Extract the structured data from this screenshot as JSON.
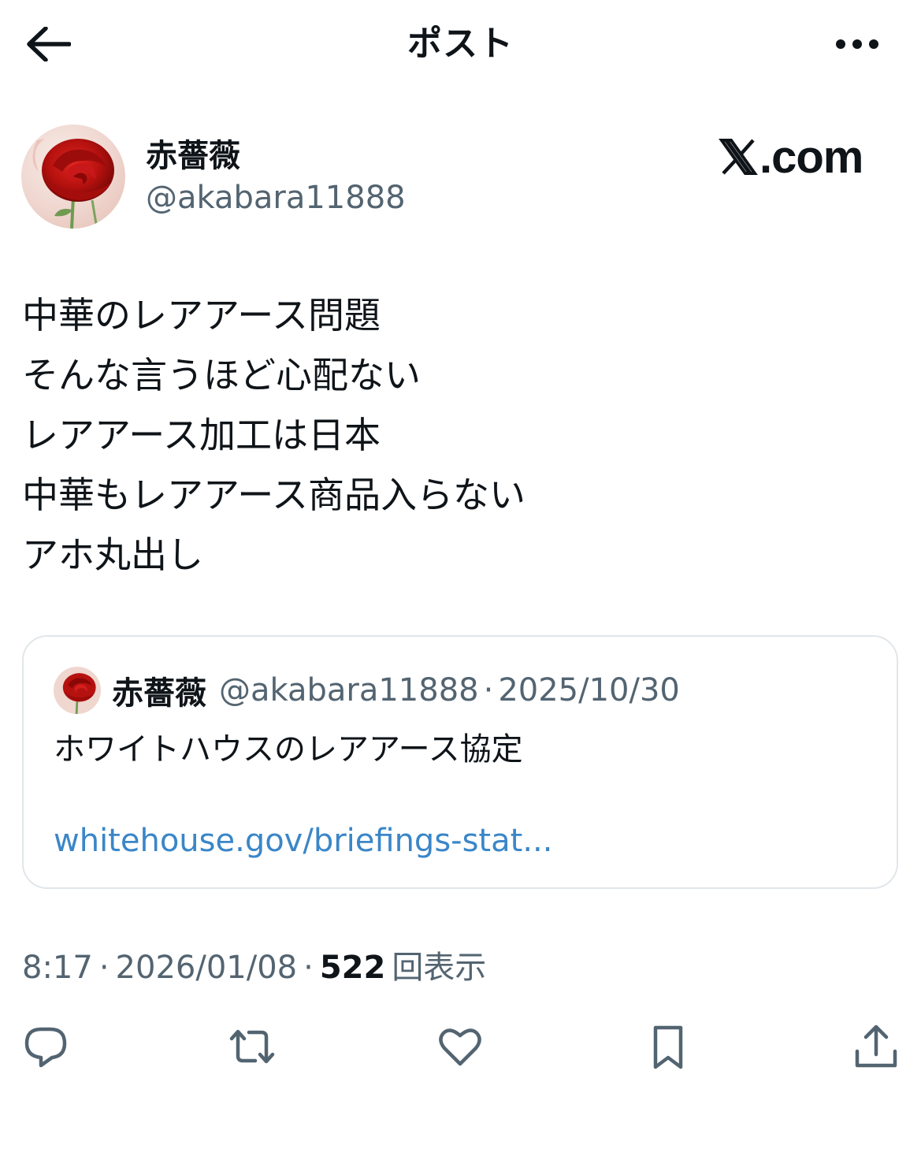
{
  "header": {
    "title": "ポスト",
    "back_icon": "arrow-left-icon",
    "more_icon": "more-horizontal-icon"
  },
  "author": {
    "name": "赤薔薇",
    "handle": "@akabara11888",
    "avatar": "red-rose-avatar"
  },
  "brand": {
    "x_glyph": "𝕏",
    "suffix": ".com"
  },
  "post": {
    "lines": [
      "中華のレアアース問題",
      "そんな言うほど心配ない",
      "レアアース加工は日本",
      "中華もレアアース商品入らない",
      "アホ丸出し"
    ]
  },
  "quote": {
    "name": "赤薔薇",
    "handle": "@akabara11888",
    "separator": "·",
    "date": "2025/10/30",
    "text": "ホワイトハウスのレアアース協定",
    "link": "whitehouse.gov/briefings-stat..."
  },
  "meta": {
    "time": "8:17",
    "separator": "·",
    "date": "2026/01/08",
    "views_count": "522",
    "views_label": "回表示"
  },
  "actions": [
    {
      "name": "reply",
      "icon": "reply-icon"
    },
    {
      "name": "repost",
      "icon": "repost-icon"
    },
    {
      "name": "like",
      "icon": "heart-icon"
    },
    {
      "name": "bookmark",
      "icon": "bookmark-icon"
    },
    {
      "name": "share",
      "icon": "share-icon"
    }
  ],
  "colors": {
    "text": "#0f1419",
    "secondary": "#536471",
    "link": "#3a86c8",
    "border": "#e1e6ea"
  }
}
